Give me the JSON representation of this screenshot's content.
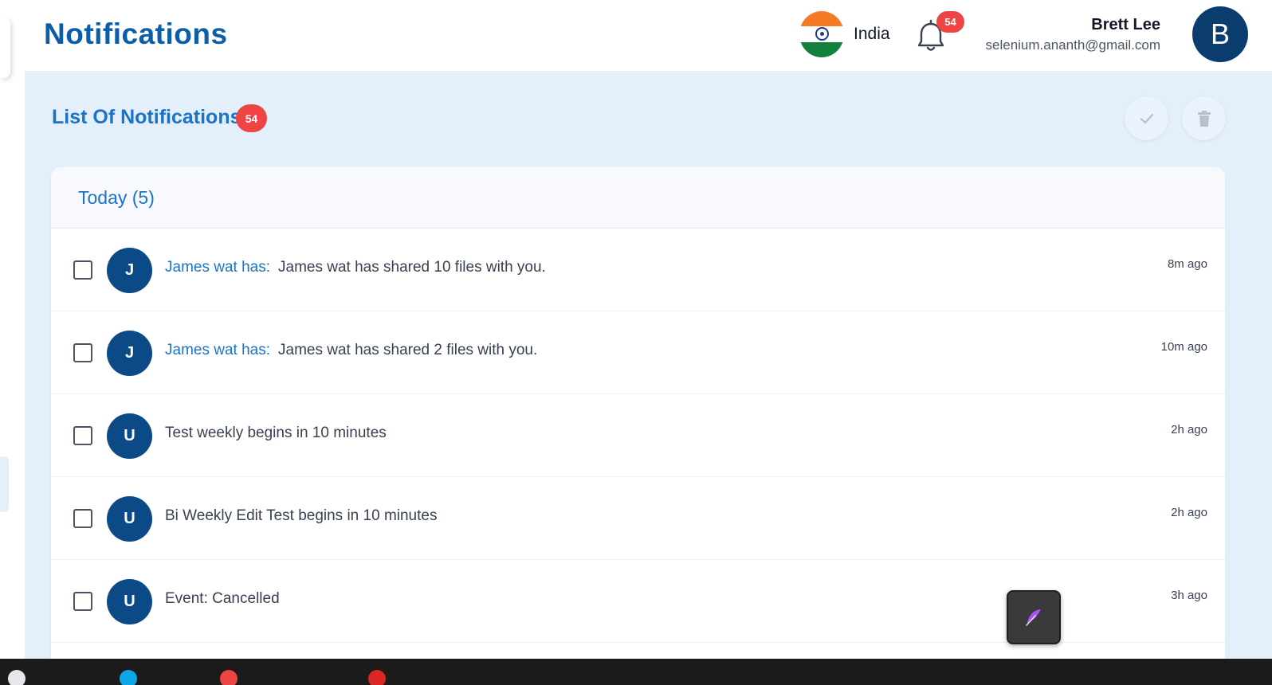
{
  "header": {
    "title": "Notifications",
    "country": {
      "label": "India",
      "flag_icon": "india-flag-icon"
    },
    "bell": {
      "icon": "bell-icon",
      "badge": "54"
    },
    "user": {
      "name": "Brett Lee",
      "email": "selenium.ananth@gmail.com",
      "avatar_initial": "B"
    }
  },
  "list": {
    "title": "List Of Notifications",
    "badge": "54",
    "actions": {
      "mark_read_icon": "check-icon",
      "delete_icon": "trash-icon"
    }
  },
  "groups": [
    {
      "title": "Today (5)",
      "items": [
        {
          "initial": "J",
          "sender": "James wat has:",
          "text": "James wat has shared 10 files with you.",
          "time": "8m ago"
        },
        {
          "initial": "J",
          "sender": "James wat has:",
          "text": "James wat has shared 2 files with you.",
          "time": "10m ago"
        },
        {
          "initial": "U",
          "sender": "",
          "text": "Test weekly begins in 10 minutes",
          "time": "2h ago"
        },
        {
          "initial": "U",
          "sender": "",
          "text": "Bi Weekly Edit Test begins in 10 minutes",
          "time": "2h ago"
        },
        {
          "initial": "U",
          "sender": "",
          "text": "Event: Cancelled",
          "time": "3h ago"
        }
      ]
    }
  ],
  "fab": {
    "icon": "feather-icon"
  },
  "colors": {
    "primary": "#0b5ea7",
    "accent": "#1a73c8",
    "badge": "#ef4444",
    "avatar": "#0b4a86",
    "background": "#e3f0fc"
  }
}
